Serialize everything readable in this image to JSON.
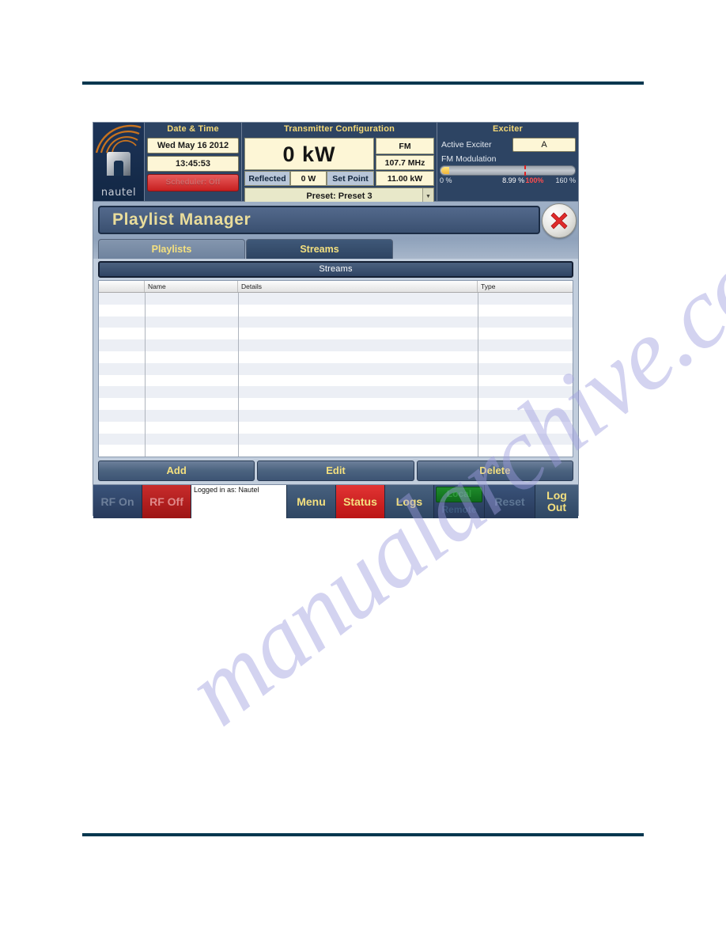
{
  "status_bar": {
    "logo": {
      "brand": "nautel"
    },
    "datetime": {
      "title": "Date & Time",
      "date": "Wed May 16 2012",
      "time": "13:45:53",
      "scheduler": "Scheduler: Off"
    },
    "transmitter": {
      "title": "Transmitter Configuration",
      "power": "0 kW",
      "mode": "FM",
      "frequency": "107.7 MHz",
      "reflected_label": "Reflected",
      "reflected_value": "0 W",
      "setpoint_label": "Set Point",
      "setpoint_value": "11.00 kW",
      "preset": "Preset: Preset 3"
    },
    "exciter": {
      "title": "Exciter",
      "active_exciter_label": "Active Exciter",
      "active_exciter_value": "A",
      "modulation_label": "FM Modulation",
      "scale_min": "0 %",
      "scale_current": "8.99 %",
      "scale_nominal": "100%",
      "scale_max": "160 %",
      "modulation_percent": 8.99,
      "nominal_percent": 100,
      "max_percent": 160
    }
  },
  "window": {
    "title": "Playlist Manager",
    "close_icon": "close-x-icon"
  },
  "tabs": [
    {
      "label": "Playlists",
      "active": false
    },
    {
      "label": "Streams",
      "active": true
    }
  ],
  "section": {
    "header": "Streams",
    "columns": [
      "",
      "Name",
      "Details",
      "Type"
    ],
    "rows": [],
    "row_count": 14
  },
  "actions": [
    {
      "label": "Add"
    },
    {
      "label": "Edit"
    },
    {
      "label": "Delete"
    }
  ],
  "toolbar": {
    "rf_on": "RF On",
    "rf_off": "RF Off",
    "logged_in": "Logged in as: Nautel",
    "menu": "Menu",
    "status": "Status",
    "logs": "Logs",
    "local": "Local",
    "remote": "Remote",
    "reset": "Reset",
    "logout_line1": "Log",
    "logout_line2": "Out"
  },
  "watermark": {
    "text": "manualarchive.com"
  },
  "colors": {
    "accent_yellow": "#f4e07f",
    "panel_blue": "#2d4463",
    "rule_teal": "#04374f",
    "alarm_red": "#c82c2c",
    "ok_green": "#1e8b2a"
  }
}
